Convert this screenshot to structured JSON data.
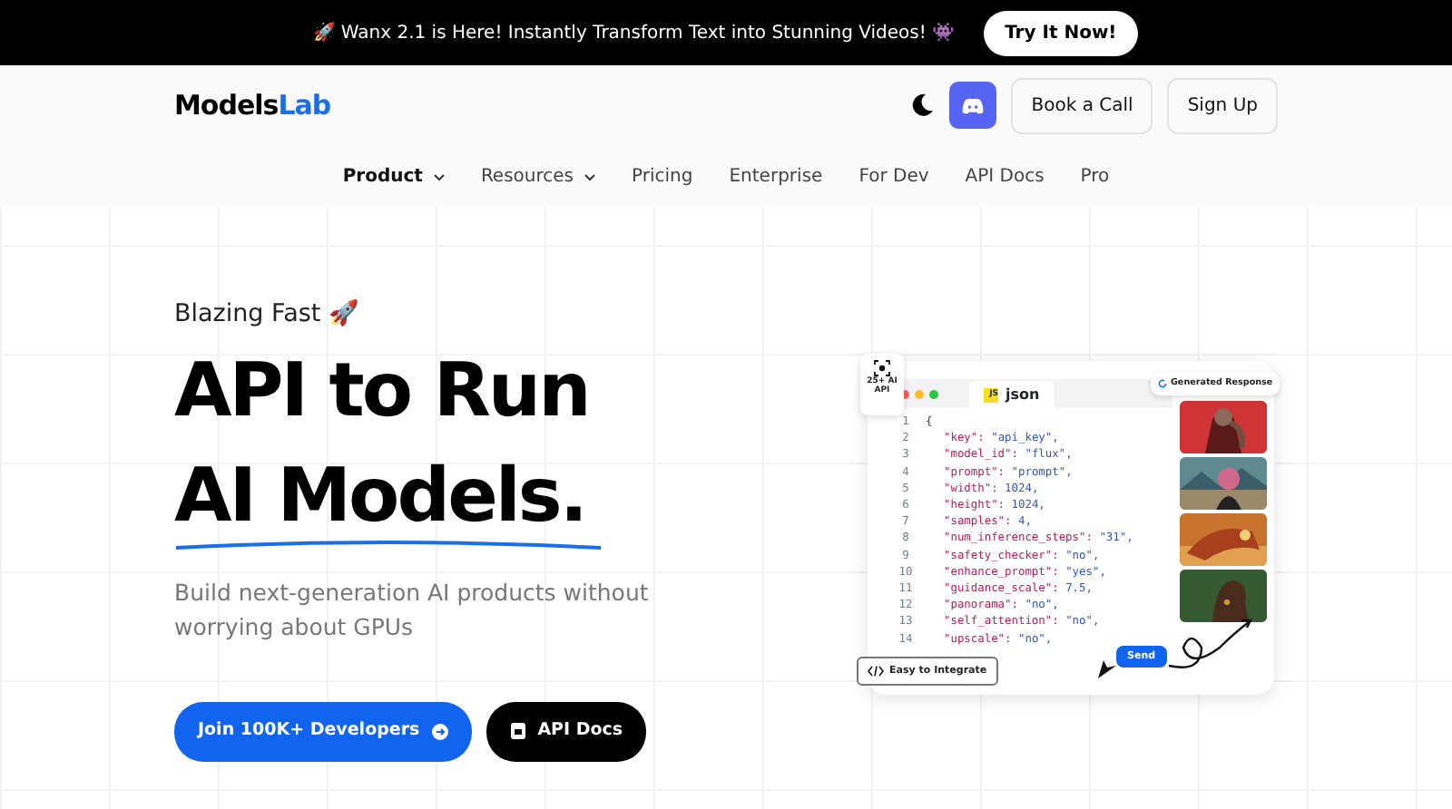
{
  "announcement": {
    "text": "🚀 Wanx 2.1 is Here! Instantly Transform Text into Stunning Videos! 👾",
    "button": "Try It Now!"
  },
  "header": {
    "logo_main": "Models",
    "logo_accent": "Lab",
    "buttons": [
      "Book a Call",
      "Sign Up"
    ]
  },
  "nav": [
    {
      "label": "Product",
      "dropdown": true,
      "selected": true
    },
    {
      "label": "Resources",
      "dropdown": true,
      "selected": false
    },
    {
      "label": "Pricing",
      "dropdown": false,
      "selected": false
    },
    {
      "label": "Enterprise",
      "dropdown": false,
      "selected": false
    },
    {
      "label": "For Dev",
      "dropdown": false,
      "selected": false
    },
    {
      "label": "API Docs",
      "dropdown": false,
      "selected": false
    },
    {
      "label": "Pro",
      "dropdown": false,
      "selected": false
    }
  ],
  "hero": {
    "eyebrow": "Blazing Fast 🚀",
    "title_lines": [
      "API to Run",
      "AI Models."
    ],
    "subtitle": "Build next-generation AI products without worrying about GPUs",
    "primary_button": "Join 100K+ Developers",
    "secondary_button": "API Docs"
  },
  "demo": {
    "badge": "25+ AI API",
    "tab": "json",
    "tab_icon": "JS",
    "response_label": "Generated Response",
    "send": "Send",
    "integrate": "Easy to Integrate",
    "lines": [
      {
        "num": "1",
        "kind": "brace",
        "text": "{"
      },
      {
        "num": "2",
        "kind": "pair",
        "key": "\"key\":",
        "value": "\"api_key\","
      },
      {
        "num": "3",
        "kind": "pair",
        "key": "\"model_id\":",
        "value": "\"flux\","
      },
      {
        "num": "4",
        "kind": "pair",
        "key": "\"prompt\":",
        "value": "\"prompt\","
      },
      {
        "num": "5",
        "kind": "pair",
        "key": "\"width\":",
        "value": "1024,"
      },
      {
        "num": "6",
        "kind": "pair",
        "key": "\"height\":",
        "value": "1024,"
      },
      {
        "num": "7",
        "kind": "pair",
        "key": "\"samples\":",
        "value": "4,"
      },
      {
        "num": "8",
        "kind": "pair",
        "key": "\"num_inference_steps\":",
        "value": "\"31\","
      },
      {
        "num": "9",
        "kind": "pair",
        "key": "\"safety_checker\":",
        "value": "\"no\","
      },
      {
        "num": "10",
        "kind": "pair",
        "key": "\"enhance_prompt\":",
        "value": "\"yes\","
      },
      {
        "num": "11",
        "kind": "pair",
        "key": "\"guidance_scale\":",
        "value": "7.5,"
      },
      {
        "num": "12",
        "kind": "pair",
        "key": "\"panorama\":",
        "value": "\"no\","
      },
      {
        "num": "13",
        "kind": "pair",
        "key": "\"self_attention\":",
        "value": "\"no\","
      },
      {
        "num": "14",
        "kind": "pair",
        "key": "\"upscale\":",
        "value": "\"no\","
      }
    ]
  }
}
